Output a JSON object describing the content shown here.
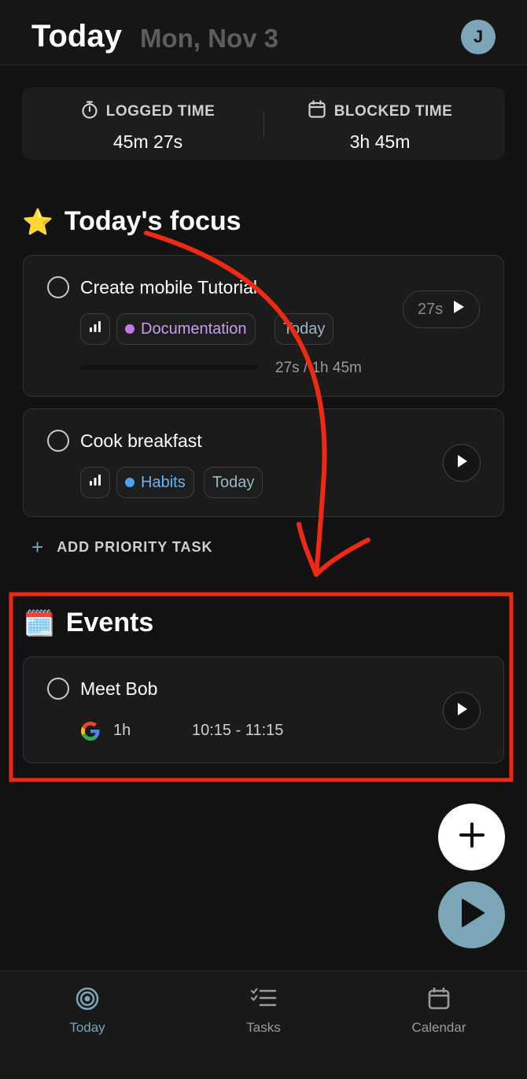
{
  "header": {
    "title": "Today",
    "date": "Mon, Nov 3",
    "avatar_initial": "J"
  },
  "stats": {
    "logged": {
      "label": "LOGGED TIME",
      "value": "45m 27s",
      "icon": "stopwatch-icon"
    },
    "blocked": {
      "label": "BLOCKED TIME",
      "value": "3h 45m",
      "icon": "calendar-icon"
    }
  },
  "focus": {
    "heading": "Today's focus",
    "emoji": "⭐",
    "tasks": [
      {
        "name": "Create mobile Tutorial",
        "project": "Documentation",
        "project_color": "#c07be8",
        "due": "Today",
        "timer": "27s",
        "progress_text": "27s / 1h 45m",
        "progress_fraction": 0.004
      },
      {
        "name": "Cook breakfast",
        "project": "Habits",
        "project_color": "#4aa3f0",
        "due": "Today"
      }
    ],
    "add_label": "ADD PRIORITY TASK"
  },
  "events": {
    "heading": "Events",
    "emoji": "🗓️",
    "items": [
      {
        "name": "Meet Bob",
        "duration": "1h",
        "time_range": "10:15 - 11:15",
        "source_icon": "google-icon"
      }
    ]
  },
  "nav": {
    "today": "Today",
    "tasks": "Tasks",
    "calendar": "Calendar"
  },
  "colors": {
    "accent": "#7aa6b8",
    "annotation": "#ee2a12"
  }
}
